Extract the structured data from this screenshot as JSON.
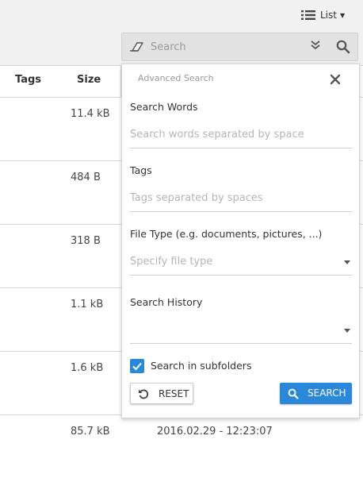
{
  "toolbar": {
    "view_label": "List",
    "view_icon": "list-icon"
  },
  "search": {
    "placeholder": "Search"
  },
  "table": {
    "headers": {
      "tags": "Tags",
      "size": "Size"
    },
    "rows": [
      {
        "size": "11.4 kB",
        "date": ""
      },
      {
        "size": "484 B",
        "date": ""
      },
      {
        "size": "318 B",
        "date": ""
      },
      {
        "size": "1.1 kB",
        "date": ""
      },
      {
        "size": "1.6 kB",
        "date": ""
      },
      {
        "size": "85.7 kB",
        "date": "2016.02.29 - 12:23:07"
      }
    ]
  },
  "advanced": {
    "title": "Advanced Search",
    "search_words": {
      "label": "Search Words",
      "placeholder": "Search words separated by space"
    },
    "tags": {
      "label": "Tags",
      "placeholder": "Tags separated by spaces"
    },
    "file_type": {
      "label": "File Type (e.g. documents, pictures, ...)",
      "placeholder": "Specify file type"
    },
    "history": {
      "label": "Search History",
      "value": ""
    },
    "subfolders": {
      "label": "Search in subfolders",
      "checked": true
    },
    "reset_label": "RESET",
    "search_label": "SEARCH"
  },
  "colors": {
    "accent": "#2b88d8",
    "topbar": "#f1f1f1"
  }
}
